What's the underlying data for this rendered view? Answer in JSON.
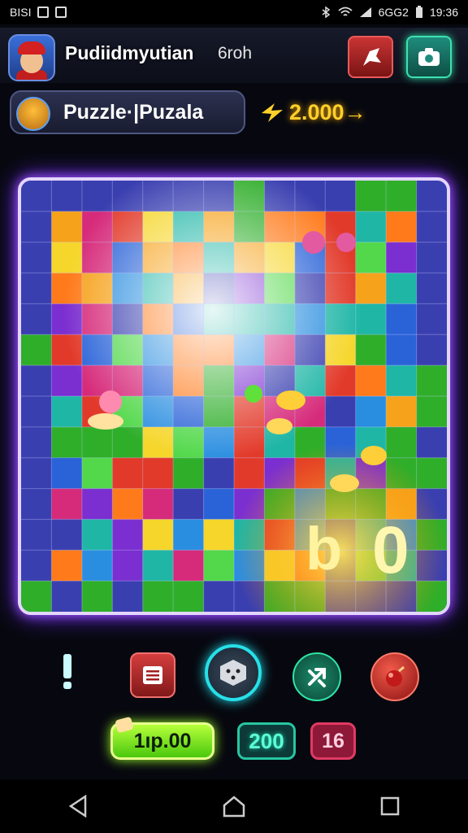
{
  "status_bar": {
    "left_text": "BISI",
    "carrier": "6GG2",
    "time": "19:36"
  },
  "header": {
    "player_name": "Pudiidmyutian",
    "player_sub": "6roh",
    "buttons": [
      {
        "icon": "alert-flag-icon"
      },
      {
        "icon": "camera-icon"
      }
    ]
  },
  "title_bar": {
    "title": "Puzzle·|Puzala"
  },
  "coins": {
    "value": "2.000→"
  },
  "board": {
    "overlay_text_left": "b",
    "overlay_text_right": "0"
  },
  "toolbar": {
    "items": [
      "alert",
      "menu",
      "dice",
      "shuffle",
      "bomb"
    ]
  },
  "footer": {
    "score": "1ıp.00",
    "count_a": "200",
    "count_b": "16"
  },
  "colors": {
    "accent_purple": "#a657ff",
    "accent_teal": "#27e0e8",
    "accent_green": "#9bff2a",
    "coin_gold": "#ffd02a"
  }
}
